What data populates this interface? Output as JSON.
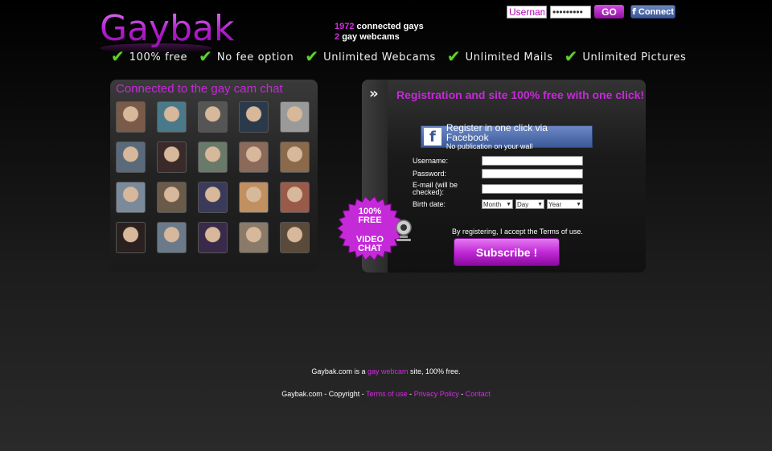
{
  "header": {
    "logo": "Gaybak",
    "stats": {
      "connected_count": "1972",
      "connected_label": "connected gays",
      "webcam_count": "2",
      "webcam_label": "gay webcams"
    },
    "login": {
      "username_value": "Username",
      "password_value": "•••••••••",
      "go_label": "GO",
      "fb_connect_label": "Connect"
    },
    "features": [
      "100% free",
      "No fee option",
      "Unlimited Webcams",
      "Unlimited Mails",
      "Unlimited Pictures"
    ]
  },
  "cam_panel": {
    "title": "Connected to the gay cam chat",
    "avatar_colors": [
      "#7a5b4a",
      "#4a7a8a",
      "#555",
      "#2a3a4a",
      "#9a9a9a",
      "#5a6a7a",
      "#3a2a2a",
      "#6a7a6a",
      "#8a6a5a",
      "#8a6a4a",
      "#7a8a9a",
      "#6a5a4a",
      "#3a3a5a",
      "#c09060",
      "#9a5a4a",
      "#2a2020",
      "#6a7a8a",
      "#3a2a4a",
      "#8a7a6a",
      "#5a4a3a"
    ]
  },
  "registration": {
    "title": "Registration and site 100% free with one click!",
    "fb_register_line1": "Register in one click via Facebook",
    "fb_register_line2": "No publication on your wall",
    "fields": {
      "username": "Username:",
      "password": "Password:",
      "email_line1": "E-mail (will be",
      "email_line2": "checked):",
      "birth": "Birth date:"
    },
    "birth_selects": {
      "month": "Month",
      "day": "Day",
      "year": "Year"
    },
    "accept_text": "By registering, I accept the Terms of use.",
    "subscribe_label": "Subscribe !"
  },
  "badge": {
    "line1": "100%",
    "line2": "FREE",
    "line3": "VIDEO",
    "line4": "CHAT",
    "color": "#c52ad8"
  },
  "footer": {
    "line1_pre": "Gaybak.com is a",
    "line1_link": "gay webcam",
    "line1_post": "site, 100% free.",
    "copyright": "Gaybak.com - Copyright -",
    "terms": "Terms of use",
    "privacy": "Privacy Policy",
    "contact": "Contact",
    "sep": "-"
  }
}
